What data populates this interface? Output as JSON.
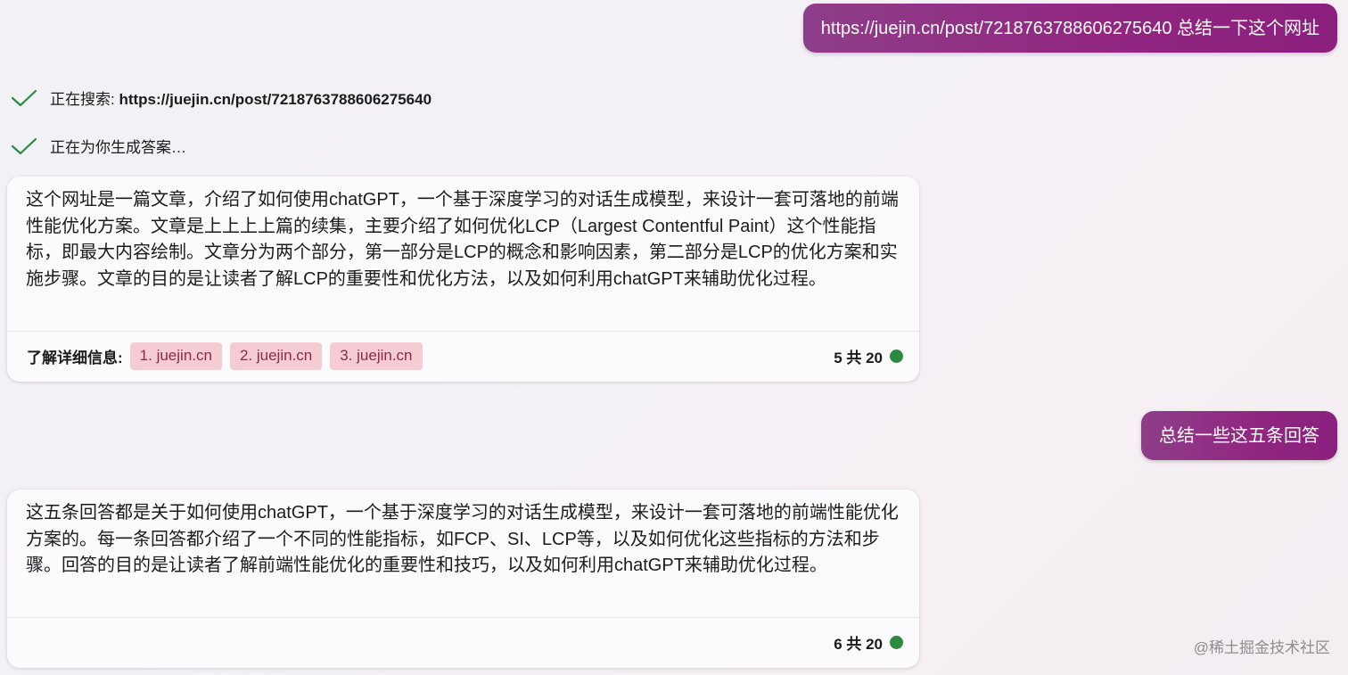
{
  "messages": {
    "user_1": "https://juejin.cn/post/7218763788606275640 总结一下这个网址",
    "status_1_prefix": "正在搜索: ",
    "status_1_query": "https://juejin.cn/post/7218763788606275640",
    "status_2": "正在为你生成答案…",
    "answer_1": "这个网址是一篇文章，介绍了如何使用chatGPT，一个基于深度学习的对话生成模型，来设计一套可落地的前端性能优化方案。文章是上上上上篇的续集，主要介绍了如何优化LCP（Largest Contentful Paint）这个性能指标，即最大内容绘制。文章分为两个部分，第一部分是LCP的概念和影响因素，第二部分是LCP的优化方案和实施步骤。文章的目的是让读者了解LCP的重要性和优化方法，以及如何利用chatGPT来辅助优化过程。",
    "learn_more_label": "了解详细信息:",
    "sources": [
      "1. juejin.cn",
      "2. juejin.cn",
      "3. juejin.cn"
    ],
    "count_1": "5 共 20",
    "user_2": "总结一些这五条回答",
    "answer_2": "这五条回答都是关于如何使用chatGPT，一个基于深度学习的对话生成模型，来设计一套可落地的前端性能优化方案的。每一条回答都介绍了一个不同的性能指标，如FCP、SI、LCP等，以及如何优化这些指标的方法和步骤。回答的目的是让读者了解前端性能优化的重要性和技巧，以及如何利用chatGPT来辅助优化过程。",
    "count_2": "6 共 20"
  },
  "watermark": "@稀土掘金技术社区",
  "colors": {
    "user_bubble": "#922782",
    "check": "#2b8a3e",
    "status_dot": "#2b8a3e",
    "chip_bg": "#f5cbd4",
    "chip_text": "#8a2c45"
  },
  "icons": {
    "status_check": "check-icon",
    "status_dot": "status-dot-icon"
  }
}
